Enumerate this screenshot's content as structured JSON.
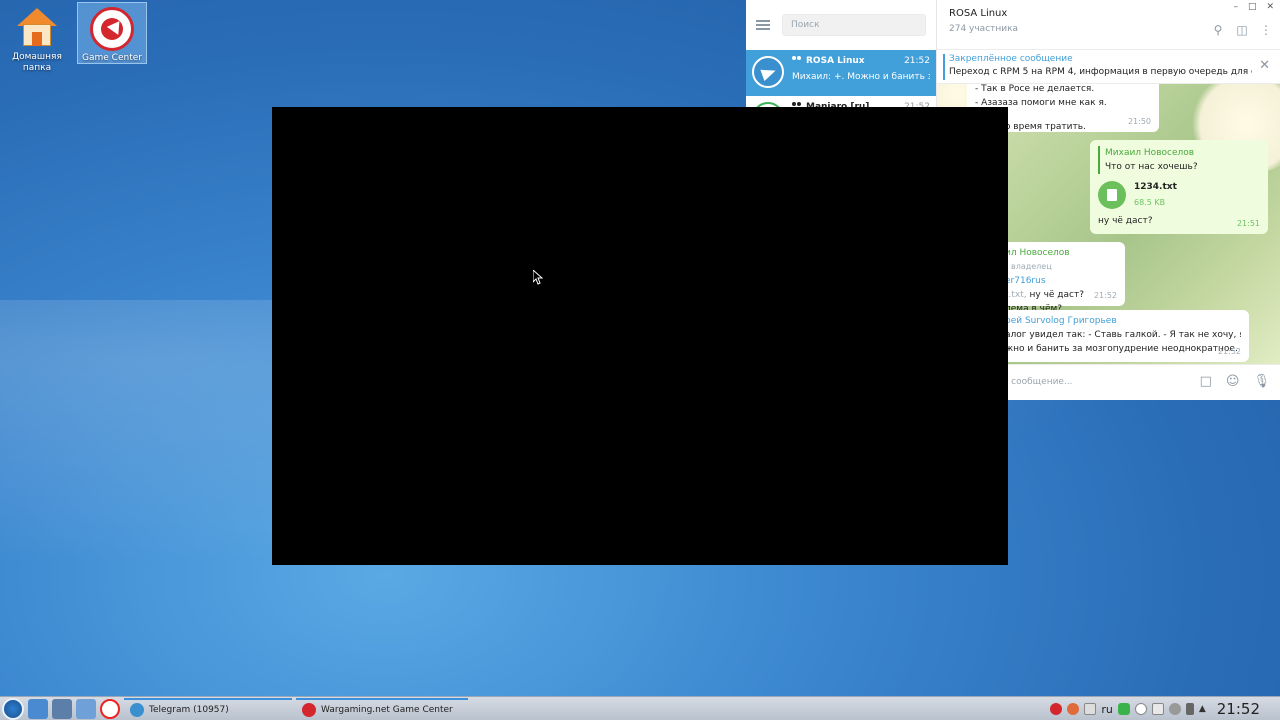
{
  "desktop": {
    "icons": [
      {
        "label": "Домашняя папка"
      },
      {
        "label": "Game Center"
      }
    ]
  },
  "telegram": {
    "search_placeholder": "Поиск",
    "chats": [
      {
        "name": "ROSA Linux",
        "time": "21:52",
        "preview": "Михаил: +. Можно и банить за ..."
      },
      {
        "name": "Manjaro [ru]",
        "time": "21:52"
      }
    ],
    "header": {
      "title": "ROSA Linux",
      "subtitle": "274 участника"
    },
    "pinned": {
      "label": "Закреплённое сообщение",
      "text": "Переход с RPM 5 на RPM 4, информация в первую очередь для сбо..."
    },
    "messages": {
      "m1_line1": "- Так в Росе не делается.",
      "m1_line2": "- Азазаза помоги мне как я.",
      "m1_line3": "нчиваю время тратить.",
      "m1_time": "21:50",
      "m2_reply_sender": "Михаил Новоселов",
      "m2_reply_text": "Что от нас хочешь?",
      "m2_file_name": "1234.txt",
      "m2_file_size": "68.5 KB",
      "m2_text": "ну чё даст?",
      "m2_time": "21:51",
      "m3_sender": "ил Новоселов",
      "m3_role": "владелец",
      "m3_reply_sender": "er716rus",
      "m3_reply_prefix": "t.txt,",
      "m3_reply_text": " ну чё даст?",
      "m3_text": "лема в чём?",
      "m3_time": "21:52",
      "m4_sender": "рей Survolog Григорьев",
      "m4_line1": "алог увидел так: - Ставь галкой. - Я так не хочу, я хоч...",
      "m4_line2": "жно и банить за мозгопудрение неоднократное.",
      "m4_time": "21:52"
    },
    "input_placeholder": "ь сообщение..."
  },
  "taskbar": {
    "tasks": [
      {
        "label": "Telegram (10957)"
      },
      {
        "label": "Wargaming.net Game Center"
      }
    ],
    "lang": "ru",
    "clock": "21:52"
  },
  "colors": {
    "accent": "#419fd9",
    "green": "#4aa93d",
    "game_center_red": "#d4262d"
  }
}
